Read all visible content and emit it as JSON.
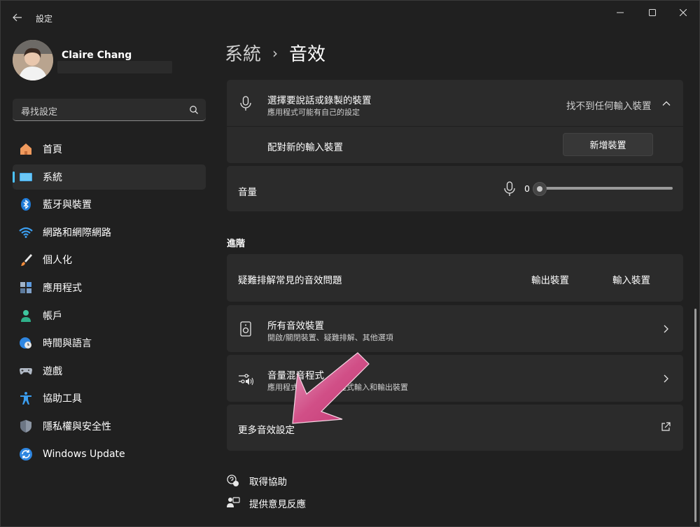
{
  "window": {
    "app_title": "設定",
    "controls": {
      "minimize": "minimize",
      "maximize": "maximize",
      "close": "close"
    }
  },
  "profile": {
    "name": "Claire Chang"
  },
  "search": {
    "placeholder": "尋找設定"
  },
  "sidebar": {
    "items": [
      {
        "label": "首頁",
        "icon": "home-icon"
      },
      {
        "label": "系統",
        "icon": "monitor-icon",
        "active": true
      },
      {
        "label": "藍牙與裝置",
        "icon": "bluetooth-icon"
      },
      {
        "label": "網路和網際網路",
        "icon": "wifi-icon"
      },
      {
        "label": "個人化",
        "icon": "brush-icon"
      },
      {
        "label": "應用程式",
        "icon": "apps-icon"
      },
      {
        "label": "帳戶",
        "icon": "person-icon"
      },
      {
        "label": "時間與語言",
        "icon": "globe-clock-icon"
      },
      {
        "label": "遊戲",
        "icon": "gamepad-icon"
      },
      {
        "label": "協助工具",
        "icon": "accessibility-icon"
      },
      {
        "label": "隱私權與安全性",
        "icon": "shield-icon"
      },
      {
        "label": "Windows Update",
        "icon": "update-icon"
      }
    ]
  },
  "breadcrumb": {
    "parent": "系統",
    "separator": "›",
    "current": "音效"
  },
  "input": {
    "title": "選擇要說話或錄製的裝置",
    "subtitle": "應用程式可能有自己的設定",
    "status": "找不到任何輸入裝置",
    "pair_label": "配對新的輸入裝置",
    "add_button": "新增裝置",
    "volume_label": "音量",
    "volume_value": "0"
  },
  "advanced": {
    "section_title": "進階",
    "troubleshoot": {
      "title": "疑難排解常見的音效問題",
      "output_button": "輸出裝置",
      "input_button": "輸入裝置"
    },
    "all_devices": {
      "title": "所有音效裝置",
      "subtitle": "開啟/關閉裝置、疑難排解、其他選項"
    },
    "mixer": {
      "title": "音量混音程式",
      "subtitle": "應用程式",
      "subtitle_tail": "用程式輸入和輸出裝置"
    },
    "more": {
      "title": "更多音效設定"
    }
  },
  "links": {
    "help": "取得協助",
    "feedback": "提供意見反應"
  },
  "colors": {
    "accent": "#4cc2ff",
    "annotation_arrow": "#d14f87"
  }
}
